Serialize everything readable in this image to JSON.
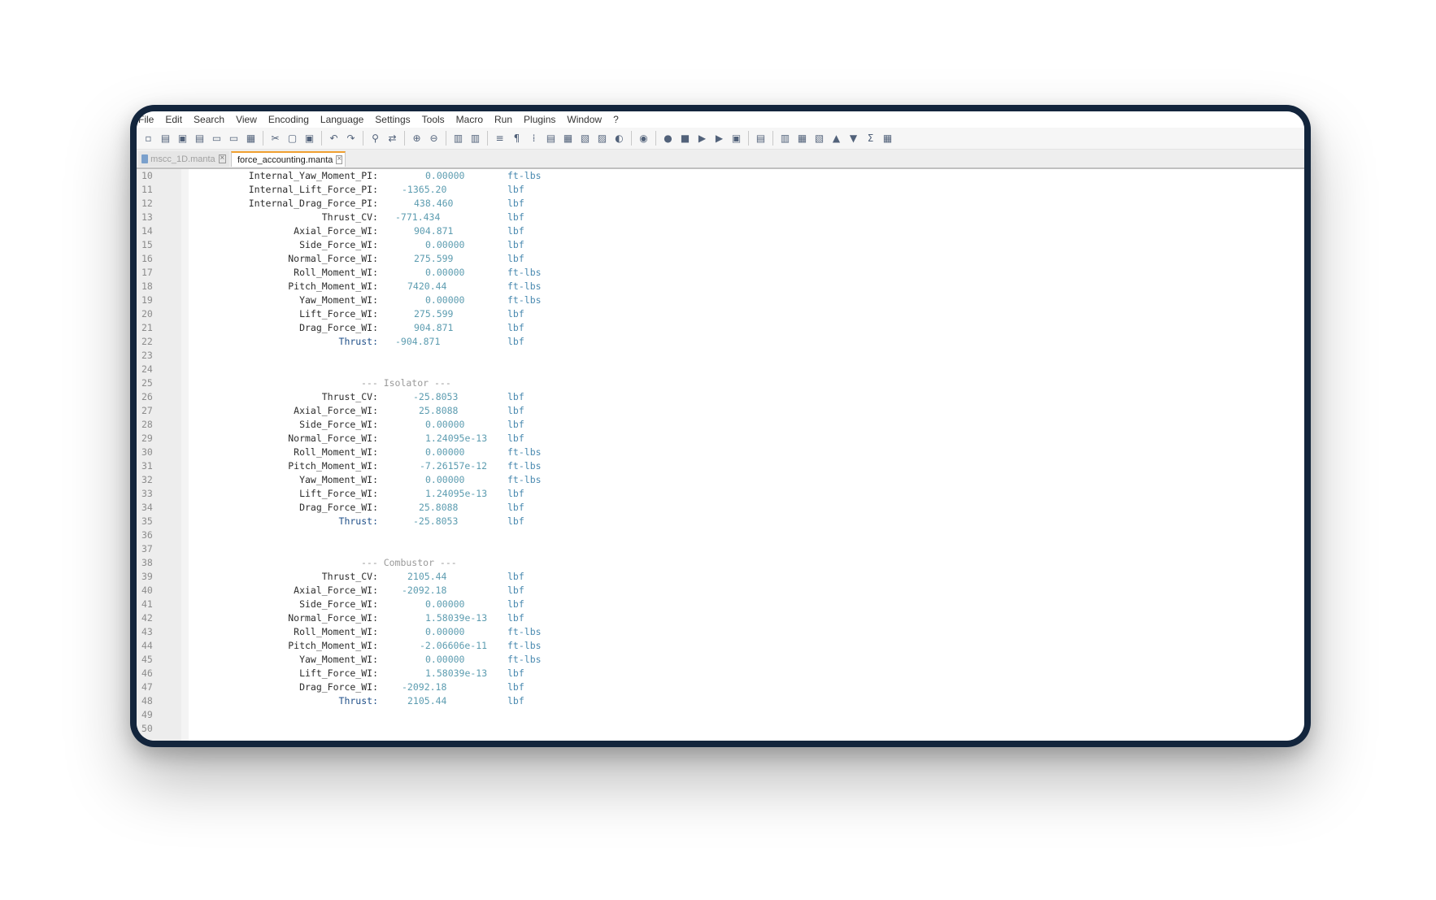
{
  "menu": [
    "File",
    "Edit",
    "Search",
    "View",
    "Encoding",
    "Language",
    "Settings",
    "Tools",
    "Macro",
    "Run",
    "Plugins",
    "Window",
    "?"
  ],
  "toolbar_icons": [
    "new-file-icon",
    "open-file-icon",
    "save-icon",
    "save-all-icon",
    "close-icon",
    "close-all-icon",
    "print-icon",
    "cut-icon",
    "copy-icon",
    "paste-icon",
    "undo-icon",
    "redo-icon",
    "find-icon",
    "replace-icon",
    "zoom-in-icon",
    "zoom-out-icon",
    "sync-v-icon",
    "sync-h-icon",
    "word-wrap-icon",
    "show-all-chars-icon",
    "indent-guide-icon",
    "lang-icon",
    "doc-map-icon",
    "function-list-icon",
    "folder-workspace-icon",
    "monitor-icon",
    "view-icon",
    "record-macro-icon",
    "stop-record-icon",
    "play-macro-icon",
    "run-macro-multiple-icon",
    "save-macro-icon",
    "clipboard-history-icon",
    "panel-icon",
    "columns-icon",
    "compare-icon",
    "arrow-up-icon",
    "arrow-down-icon",
    "sum-icon",
    "grid-icon"
  ],
  "tabs": [
    {
      "label": "mscc_1D.manta",
      "active": false
    },
    {
      "label": "force_accounting.manta",
      "active": true
    }
  ],
  "lines": [
    {
      "n": "10",
      "label": "Internal_Yaw_Moment_PI:",
      "value": "0.00000",
      "unit": "ft-lbs"
    },
    {
      "n": "11",
      "label": "Internal_Lift_Force_PI:",
      "value": "-1365.20",
      "unit": "lbf"
    },
    {
      "n": "12",
      "label": "Internal_Drag_Force_PI:",
      "value": "438.460",
      "unit": "lbf"
    },
    {
      "n": "13",
      "label": "Thrust_CV:",
      "value": "-771.434",
      "unit": "lbf"
    },
    {
      "n": "14",
      "label": "Axial_Force_WI:",
      "value": "904.871",
      "unit": "lbf"
    },
    {
      "n": "15",
      "label": "Side_Force_WI:",
      "value": "0.00000",
      "unit": "lbf"
    },
    {
      "n": "16",
      "label": "Normal_Force_WI:",
      "value": "275.599",
      "unit": "lbf"
    },
    {
      "n": "17",
      "label": "Roll_Moment_WI:",
      "value": "0.00000",
      "unit": "ft-lbs"
    },
    {
      "n": "18",
      "label": "Pitch_Moment_WI:",
      "value": "7420.44",
      "unit": "ft-lbs"
    },
    {
      "n": "19",
      "label": "Yaw_Moment_WI:",
      "value": "0.00000",
      "unit": "ft-lbs"
    },
    {
      "n": "20",
      "label": "Lift_Force_WI:",
      "value": "275.599",
      "unit": "lbf"
    },
    {
      "n": "21",
      "label": "Drag_Force_WI:",
      "value": "904.871",
      "unit": "lbf"
    },
    {
      "n": "22",
      "label": "Thrust:",
      "value": "-904.871",
      "unit": "lbf",
      "blue": true
    },
    {
      "n": "23"
    },
    {
      "n": "24"
    },
    {
      "n": "25",
      "header": "--- Isolator ---"
    },
    {
      "n": "26",
      "label": "Thrust_CV:",
      "value": "-25.8053",
      "unit": "lbf"
    },
    {
      "n": "27",
      "label": "Axial_Force_WI:",
      "value": "25.8088",
      "unit": "lbf"
    },
    {
      "n": "28",
      "label": "Side_Force_WI:",
      "value": "0.00000",
      "unit": "lbf"
    },
    {
      "n": "29",
      "label": "Normal_Force_WI:",
      "value": "1.24095e-13",
      "unit": "lbf"
    },
    {
      "n": "30",
      "label": "Roll_Moment_WI:",
      "value": "0.00000",
      "unit": "ft-lbs"
    },
    {
      "n": "31",
      "label": "Pitch_Moment_WI:",
      "value": "-7.26157e-12",
      "unit": "ft-lbs"
    },
    {
      "n": "32",
      "label": "Yaw_Moment_WI:",
      "value": "0.00000",
      "unit": "ft-lbs"
    },
    {
      "n": "33",
      "label": "Lift_Force_WI:",
      "value": "1.24095e-13",
      "unit": "lbf"
    },
    {
      "n": "34",
      "label": "Drag_Force_WI:",
      "value": "25.8088",
      "unit": "lbf"
    },
    {
      "n": "35",
      "label": "Thrust:",
      "value": "-25.8053",
      "unit": "lbf",
      "blue": true
    },
    {
      "n": "36"
    },
    {
      "n": "37"
    },
    {
      "n": "38",
      "header": "--- Combustor ---"
    },
    {
      "n": "39",
      "label": "Thrust_CV:",
      "value": "2105.44",
      "unit": "lbf"
    },
    {
      "n": "40",
      "label": "Axial_Force_WI:",
      "value": "-2092.18",
      "unit": "lbf"
    },
    {
      "n": "41",
      "label": "Side_Force_WI:",
      "value": "0.00000",
      "unit": "lbf"
    },
    {
      "n": "42",
      "label": "Normal_Force_WI:",
      "value": "1.58039e-13",
      "unit": "lbf"
    },
    {
      "n": "43",
      "label": "Roll_Moment_WI:",
      "value": "0.00000",
      "unit": "ft-lbs"
    },
    {
      "n": "44",
      "label": "Pitch_Moment_WI:",
      "value": "-2.06606e-11",
      "unit": "ft-lbs"
    },
    {
      "n": "45",
      "label": "Yaw_Moment_WI:",
      "value": "0.00000",
      "unit": "ft-lbs"
    },
    {
      "n": "46",
      "label": "Lift_Force_WI:",
      "value": "1.58039e-13",
      "unit": "lbf"
    },
    {
      "n": "47",
      "label": "Drag_Force_WI:",
      "value": "-2092.18",
      "unit": "lbf"
    },
    {
      "n": "48",
      "label": "Thrust:",
      "value": "2105.44",
      "unit": "lbf",
      "blue": true
    },
    {
      "n": "49"
    },
    {
      "n": "50"
    }
  ]
}
